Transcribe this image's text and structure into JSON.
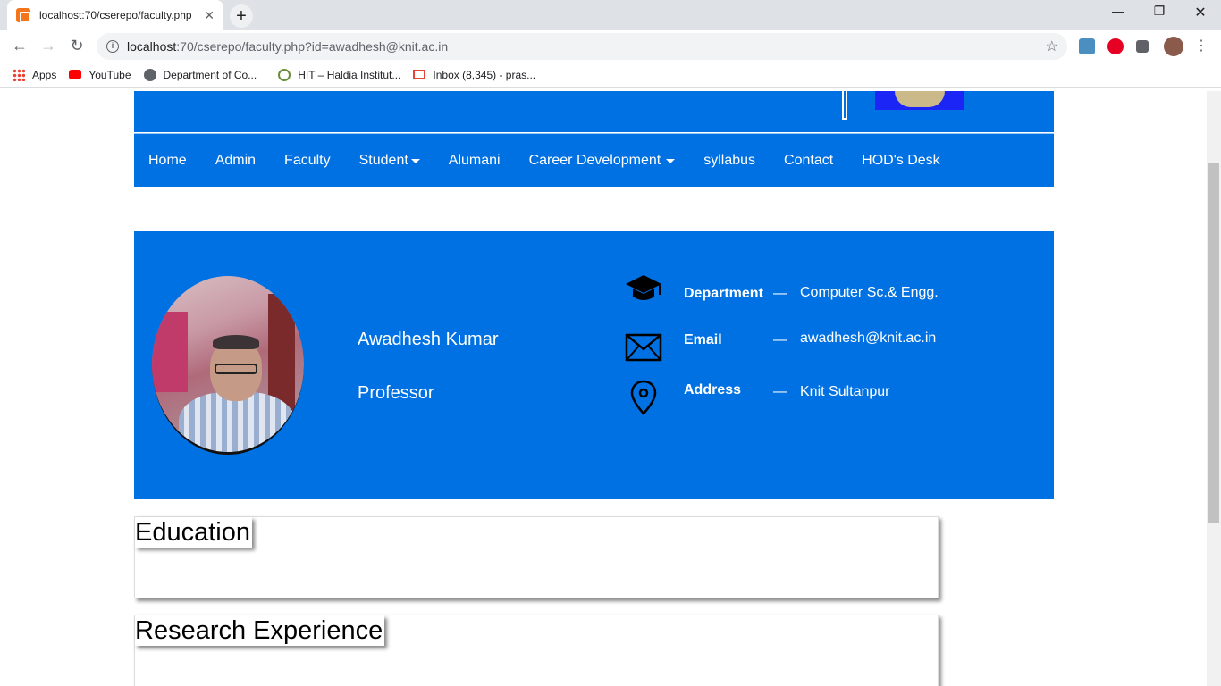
{
  "browser": {
    "tab_title": "localhost:70/cserepo/faculty.php",
    "url_host": "localhost",
    "url_path": ":70/cserepo/faculty.php?id=awadhesh@knit.ac.in",
    "bookmarks": [
      {
        "label": "Apps",
        "icon": "apps-grid-icon"
      },
      {
        "label": "YouTube",
        "icon": "youtube-icon"
      },
      {
        "label": "Department of Co...",
        "icon": "globe-icon"
      },
      {
        "label": "HIT – Haldia Institut...",
        "icon": "hit-icon"
      },
      {
        "label": "Inbox (8,345) - pras...",
        "icon": "gmail-icon"
      }
    ]
  },
  "nav": {
    "items": [
      "Home",
      "Admin",
      "Faculty",
      "Student",
      "Alumani",
      "Career Development",
      "syllabus",
      "Contact",
      "HOD's Desk"
    ]
  },
  "profile": {
    "name": "Awadhesh Kumar",
    "designation": "Professor",
    "department_label": "Department",
    "department_value": "Computer Sc.& Engg.",
    "email_label": "Email",
    "email_value": "awadhesh@knit.ac.in",
    "address_label": "Address",
    "address_value": "Knit Sultanpur",
    "dash": "—"
  },
  "sections": {
    "education": "Education",
    "research": "Research Experience"
  },
  "colors": {
    "brand_blue": "#0071e2"
  }
}
